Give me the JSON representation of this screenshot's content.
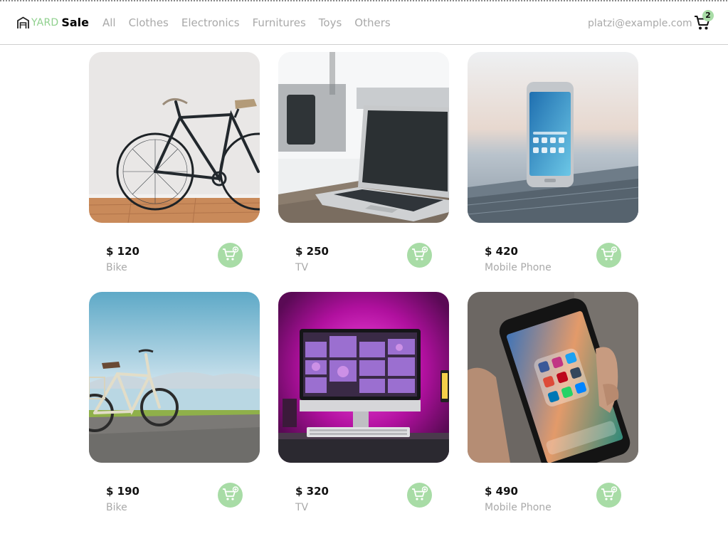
{
  "brand": {
    "yard": "YARD",
    "sale": "Sale"
  },
  "nav": {
    "categories": [
      "All",
      "Clothes",
      "Electronics",
      "Furnitures",
      "Toys",
      "Others"
    ]
  },
  "account": {
    "email": "platzi@example.com",
    "cart_count": "2"
  },
  "products": [
    {
      "price": "$ 120",
      "name": "Bike",
      "image": "bicycle-against-wall"
    },
    {
      "price": "$ 250",
      "name": "TV",
      "image": "laptop-on-desk"
    },
    {
      "price": "$ 420",
      "name": "Mobile Phone",
      "image": "smartphone-on-wood"
    },
    {
      "price": "$ 190",
      "name": "Bike",
      "image": "bicycle-by-lake"
    },
    {
      "price": "$ 320",
      "name": "TV",
      "image": "monitor-pink-light"
    },
    {
      "price": "$ 490",
      "name": "Mobile Phone",
      "image": "phone-in-hand"
    }
  ],
  "colors": {
    "accent": "#a8dca6",
    "muted_text": "#a9a9a9",
    "brand_green": "#8fd08d"
  },
  "icons": {
    "logo": "house-icon",
    "cart": "shopping-cart-icon",
    "add_to_cart": "add-to-cart-icon"
  }
}
